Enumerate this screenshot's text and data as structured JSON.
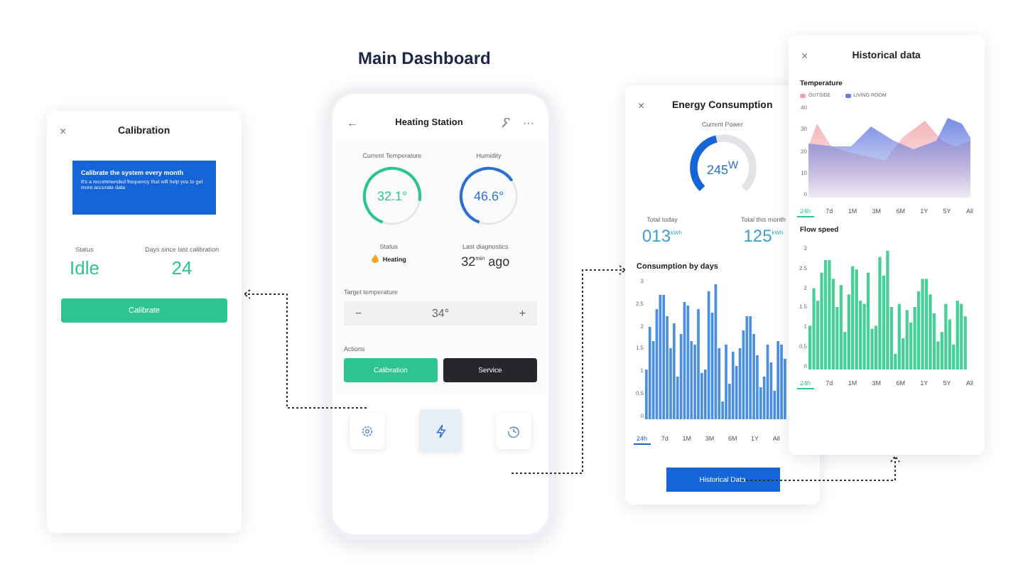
{
  "title": "Main Dashboard",
  "calibration": {
    "close": "×",
    "title": "Calibration",
    "notice": {
      "heading": "Calibrate the system every month",
      "body": "It's a recommended frequency that will help you to get more accurate data"
    },
    "stats": [
      {
        "label": "Status",
        "value": "Idle"
      },
      {
        "label": "Days since last calibration",
        "value": "24"
      }
    ],
    "button": "Calibrate"
  },
  "dashboard": {
    "back": "←",
    "title": "Heating Station",
    "more": "···",
    "gauges": [
      {
        "label": "Current Temperature",
        "value": "32.1°",
        "color": "#2ec48f"
      },
      {
        "label": "Humidity",
        "value": "46.6°",
        "color": "#2e6fd0"
      }
    ],
    "status": {
      "label": "Status",
      "value": "Heating"
    },
    "diagnostics": {
      "label": "Last diagnostics",
      "value": "32$^{min}$ ago"
    },
    "target": {
      "label": "Target temperature",
      "minus": "−",
      "value": "34°",
      "plus": "+"
    },
    "actions": {
      "label": "Actions",
      "buttons": [
        {
          "label": "Calibration",
          "kind": "primary"
        },
        {
          "label": "Service",
          "kind": "dark"
        }
      ]
    },
    "nav": [
      {
        "kind": "settings",
        "selected": false
      },
      {
        "kind": "power",
        "selected": true
      },
      {
        "kind": "history",
        "selected": false
      }
    ]
  },
  "energy": {
    "close": "×",
    "title": "Energy Consumption",
    "power": {
      "label": "Current Power",
      "value": "245$^{W}$"
    },
    "totals": [
      {
        "label": "Total today",
        "value": "013$^{kWh}$"
      },
      {
        "label": "Total this month",
        "value": "125$^{kWh}$"
      }
    ],
    "chart_title": "Consumption by days",
    "yticks": [
      "3",
      "2.5",
      "2",
      "1.5",
      "1",
      "0.5",
      "0"
    ],
    "ranges": [
      {
        "label": "24h",
        "selected": true
      },
      {
        "label": "7d",
        "selected": false
      },
      {
        "label": "1M",
        "selected": false
      },
      {
        "label": "3M",
        "selected": false
      },
      {
        "label": "6M",
        "selected": false
      },
      {
        "label": "1Y",
        "selected": false
      },
      {
        "label": "All",
        "selected": false
      }
    ],
    "button": "Historical Data"
  },
  "history": {
    "close": "×",
    "title": "Historical data",
    "temperature": {
      "title": "Temperature",
      "legend": [
        {
          "label": "OUTSIDE",
          "color": "#f2a3a8"
        },
        {
          "label": "LIVING ROOM",
          "color": "#6a7fe0"
        }
      ],
      "yticks": [
        "40",
        "30",
        "20",
        "10",
        "0"
      ],
      "ranges": [
        {
          "label": "24h",
          "selected": true
        },
        {
          "label": "7d",
          "selected": false
        },
        {
          "label": "1M",
          "selected": false
        },
        {
          "label": "3M",
          "selected": false
        },
        {
          "label": "6M",
          "selected": false
        },
        {
          "label": "1Y",
          "selected": false
        },
        {
          "label": "5Y",
          "selected": false
        },
        {
          "label": "All",
          "selected": false
        }
      ]
    },
    "flow": {
      "title": "Flow speed",
      "yticks": [
        "3",
        "2.5",
        "2",
        "1.5",
        "1",
        "0.5",
        "0"
      ],
      "ranges": [
        {
          "label": "24h",
          "selected": true
        },
        {
          "label": "7d",
          "selected": false
        },
        {
          "label": "1M",
          "selected": false
        },
        {
          "label": "3M",
          "selected": false
        },
        {
          "label": "6M",
          "selected": false
        },
        {
          "label": "1Y",
          "selected": false
        },
        {
          "label": "5Y",
          "selected": false
        },
        {
          "label": "All",
          "selected": false
        }
      ]
    }
  }
}
